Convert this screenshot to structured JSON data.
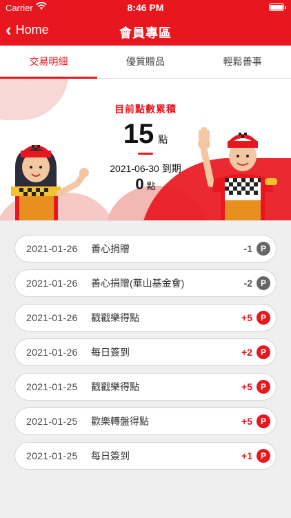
{
  "status": {
    "carrier": "Carrier",
    "time": "8:46 PM"
  },
  "nav": {
    "back_label": "Home",
    "title": "會員專區"
  },
  "tabs": [
    {
      "label": "交易明細",
      "active": true
    },
    {
      "label": "優質贈品",
      "active": false
    },
    {
      "label": "輕鬆善事",
      "active": false
    }
  ],
  "points": {
    "label": "目前點數累積",
    "current": "15",
    "unit": "點",
    "expire_text": "2021-06-30 到期",
    "expiring": "0",
    "expiring_unit": "點"
  },
  "transactions": [
    {
      "date": "2021-01-26",
      "desc": "善心捐贈",
      "points": "-1",
      "coin": "P",
      "type": "neg"
    },
    {
      "date": "2021-01-26",
      "desc": "善心捐贈(華山基金會)",
      "points": "-2",
      "coin": "P",
      "type": "neg"
    },
    {
      "date": "2021-01-26",
      "desc": "戳戳樂得點",
      "points": "+5",
      "coin": "P",
      "type": "pos"
    },
    {
      "date": "2021-01-26",
      "desc": "每日簽到",
      "points": "+2",
      "coin": "P",
      "type": "pos"
    },
    {
      "date": "2021-01-25",
      "desc": "戳戳樂得點",
      "points": "+5",
      "coin": "P",
      "type": "pos"
    },
    {
      "date": "2021-01-25",
      "desc": "歡樂轉盤得點",
      "points": "+5",
      "coin": "P",
      "type": "pos"
    },
    {
      "date": "2021-01-25",
      "desc": "每日簽到",
      "points": "+1",
      "coin": "P",
      "type": "pos"
    }
  ],
  "colors": {
    "brand": "#e8171f",
    "negative_coin": "#666666"
  }
}
